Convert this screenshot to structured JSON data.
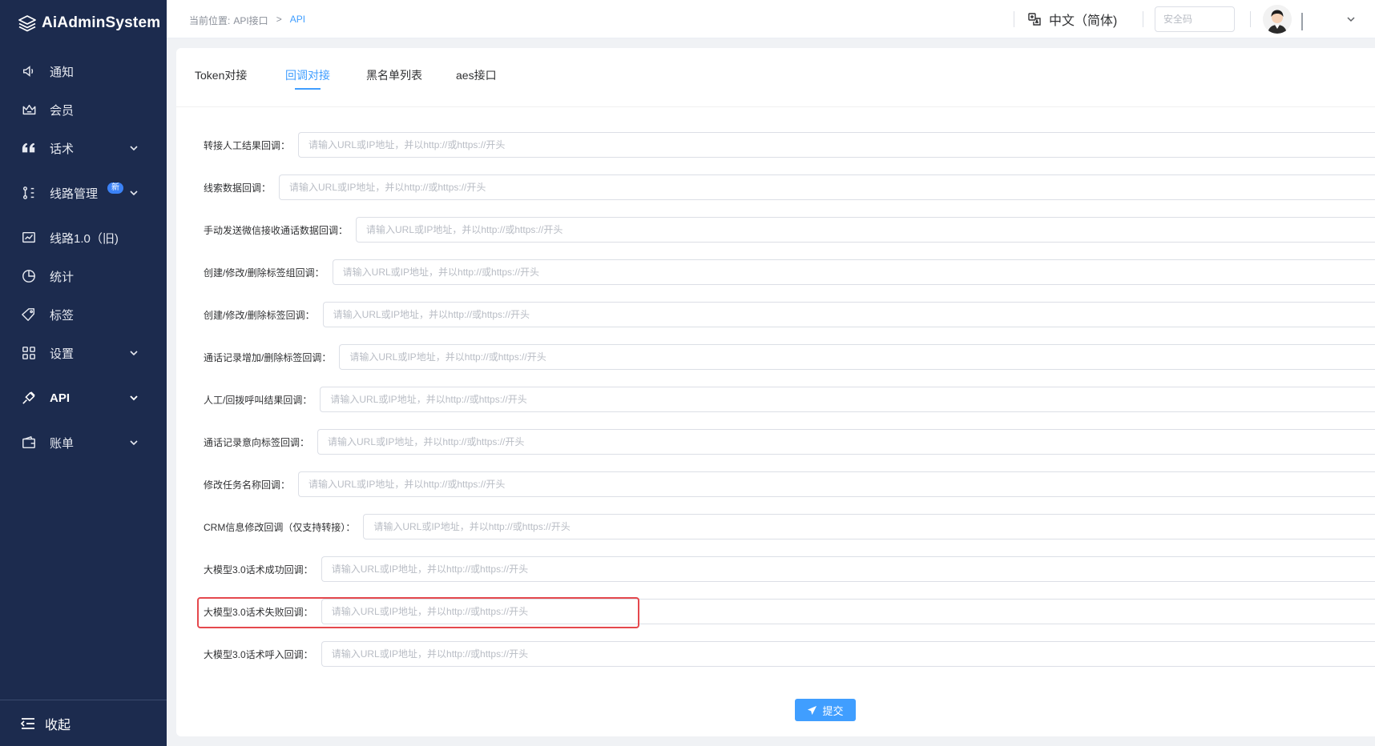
{
  "sidebar": {
    "brand": "AiAdminSystem",
    "items": [
      {
        "label": "通知",
        "icon": "speaker-icon"
      },
      {
        "label": "会员",
        "icon": "crown-icon"
      },
      {
        "label": "话术",
        "icon": "quote-icon"
      },
      {
        "label": "线路管理",
        "icon": "route-icon",
        "badge": "新"
      },
      {
        "label": "线路1.0（旧)",
        "icon": "chart-monitor-icon"
      },
      {
        "label": "统计",
        "icon": "pie-chart-icon"
      },
      {
        "label": "标签",
        "icon": "tag-icon"
      },
      {
        "label": "设置",
        "icon": "grid-icon"
      },
      {
        "label": "API",
        "icon": "plug-icon"
      },
      {
        "label": "账单",
        "icon": "wallet-icon"
      }
    ],
    "collapse_label": "收起"
  },
  "header": {
    "breadcrumb_prefix": "当前位置:",
    "breadcrumb_parent": "API接口",
    "breadcrumb_sep": ">",
    "breadcrumb_current": "API",
    "language": "中文（简体)",
    "security_placeholder": "安全码"
  },
  "tabs": [
    {
      "label": "Token对接"
    },
    {
      "label": "回调对接"
    },
    {
      "label": "黑名单列表"
    },
    {
      "label": "aes接口"
    }
  ],
  "form": {
    "placeholder": "请输入URL或IP地址，并以http://或https://开头",
    "fields": [
      {
        "label": "转接人工结果回调："
      },
      {
        "label": "线索数据回调："
      },
      {
        "label": "手动发送微信接收通话数据回调："
      },
      {
        "label": "创建/修改/删除标签组回调："
      },
      {
        "label": "创建/修改/删除标签回调："
      },
      {
        "label": "通话记录增加/删除标签回调："
      },
      {
        "label": "人工/回拨呼叫结果回调："
      },
      {
        "label": "通话记录意向标签回调："
      },
      {
        "label": "修改任务名称回调："
      },
      {
        "label": "CRM信息修改回调（仅支持转接）："
      },
      {
        "label": "大模型3.0话术成功回调："
      },
      {
        "label": "大模型3.0话术失败回调："
      },
      {
        "label": "大模型3.0话术呼入回调："
      }
    ],
    "submit_label": "提交"
  },
  "colors": {
    "sidebar_bg": "#1c2b4e",
    "accent": "#409eff",
    "highlight": "#e5484d"
  }
}
